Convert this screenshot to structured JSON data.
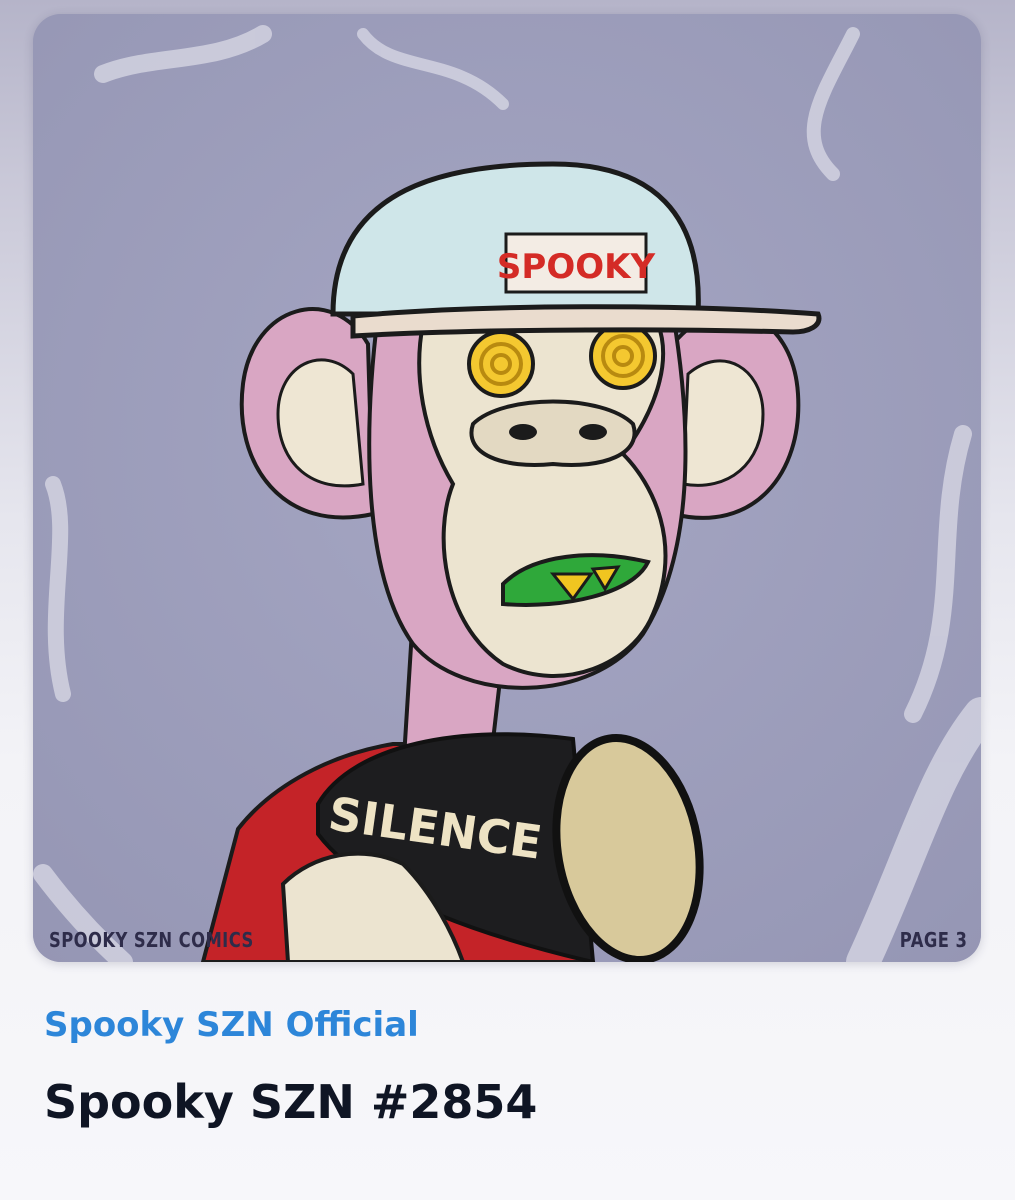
{
  "nft": {
    "artwork": {
      "cap_text": "SPOOKY",
      "megaphone_text": "SILENCE",
      "comic_label": "SPOOKY SZN COMICS",
      "page_label": "PAGE 3"
    },
    "collection_name": "Spooky SZN Official",
    "token_name": "Spooky SZN #2854"
  },
  "colors": {
    "collection_link": "#2d86d9",
    "title_text": "#0f1524",
    "art_background": "#9fa0bd"
  }
}
